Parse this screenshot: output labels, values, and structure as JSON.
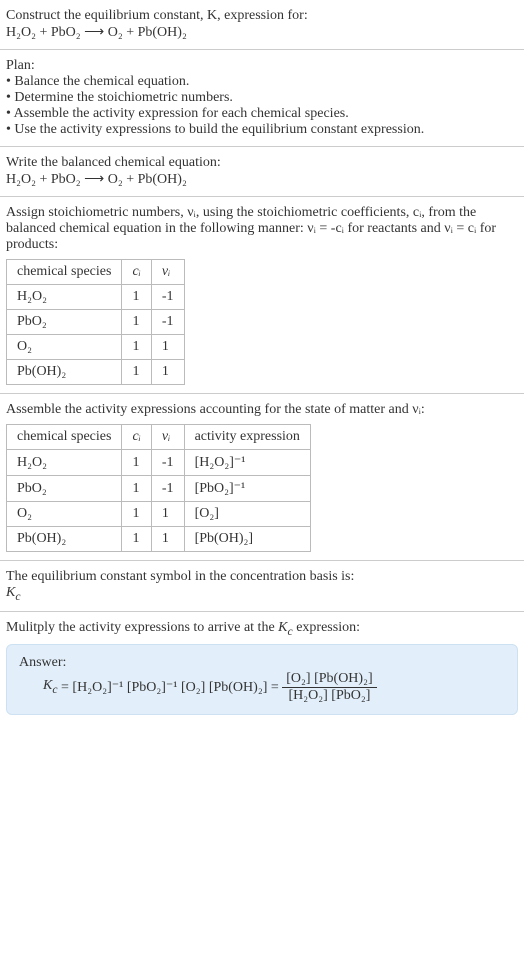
{
  "construct": {
    "heading": "Construct the equilibrium constant, K, expression for:",
    "equation": "H₂O₂ + PbO₂ ⟶ O₂ + Pb(OH)₂"
  },
  "plan": {
    "heading": "Plan:",
    "items": [
      "• Balance the chemical equation.",
      "• Determine the stoichiometric numbers.",
      "• Assemble the activity expression for each chemical species.",
      "• Use the activity expressions to build the equilibrium constant expression."
    ]
  },
  "balanced": {
    "heading": "Write the balanced chemical equation:",
    "equation": "H₂O₂ + PbO₂ ⟶ O₂ + Pb(OH)₂"
  },
  "assign": {
    "text": "Assign stoichiometric numbers, νᵢ, using the stoichiometric coefficients, cᵢ, from the balanced chemical equation in the following manner: νᵢ = -cᵢ for reactants and νᵢ = cᵢ for products:",
    "headers": [
      "chemical species",
      "cᵢ",
      "νᵢ"
    ],
    "rows": [
      [
        "H₂O₂",
        "1",
        "-1"
      ],
      [
        "PbO₂",
        "1",
        "-1"
      ],
      [
        "O₂",
        "1",
        "1"
      ],
      [
        "Pb(OH)₂",
        "1",
        "1"
      ]
    ]
  },
  "assemble": {
    "text": "Assemble the activity expressions accounting for the state of matter and νᵢ:",
    "headers": [
      "chemical species",
      "cᵢ",
      "νᵢ",
      "activity expression"
    ],
    "rows": [
      [
        "H₂O₂",
        "1",
        "-1",
        "[H₂O₂]⁻¹"
      ],
      [
        "PbO₂",
        "1",
        "-1",
        "[PbO₂]⁻¹"
      ],
      [
        "O₂",
        "1",
        "1",
        "[O₂]"
      ],
      [
        "Pb(OH)₂",
        "1",
        "1",
        "[Pb(OH)₂]"
      ]
    ]
  },
  "symbol": {
    "text": "The equilibrium constant symbol in the concentration basis is:",
    "value": "K_c"
  },
  "multiply": {
    "text": "Mulitply the activity expressions to arrive at the K_c expression:"
  },
  "answer": {
    "label": "Answer:",
    "expr_left": "K_c = [H₂O₂]⁻¹ [PbO₂]⁻¹ [O₂] [Pb(OH)₂] = ",
    "frac_top": "[O₂] [Pb(OH)₂]",
    "frac_bot": "[H₂O₂] [PbO₂]"
  }
}
